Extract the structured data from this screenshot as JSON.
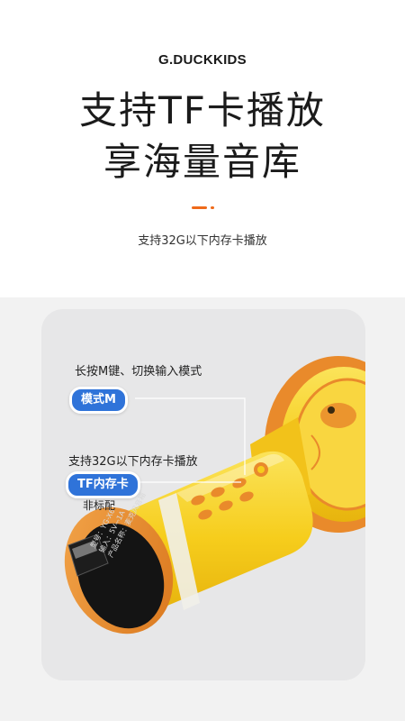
{
  "header": {
    "brand": "G.DUCKKIDS",
    "headline_line1": "支持TF卡播放",
    "headline_line2": "享海量音库",
    "subheadline": "支持32G以下内存卡播放"
  },
  "feature_card": {
    "note_mode": "长按M键、切换输入模式",
    "mode_tag": "模式M",
    "note_tf": "支持32G以下内存卡播放",
    "tf_tag": "TF内存卡",
    "footnote": "非标配"
  },
  "device_label": {
    "model": "型号：YG-X6",
    "input": "输入：5V⎓1A",
    "product_name": "产品名称：麦克风音箱"
  },
  "colors": {
    "accent_orange": "#ef6a1a",
    "tag_blue": "#2f73d9",
    "device_yellow": "#f6cd1c",
    "device_orange": "#e98a2b"
  }
}
